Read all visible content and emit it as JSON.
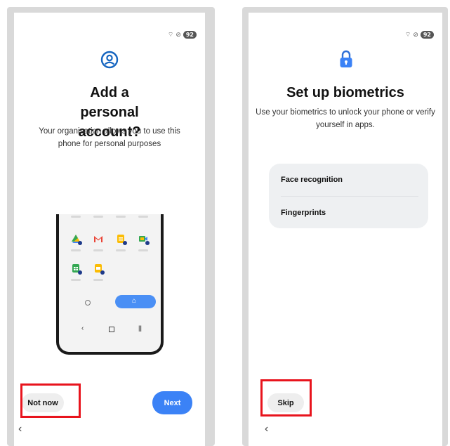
{
  "left_screen": {
    "status": {
      "battery": "92"
    },
    "icon": "account-circle-icon",
    "title": "Add a personal account?",
    "subtitle": "Your organisation allows you to use this phone for personal purposes",
    "apps": [
      "drive-icon",
      "gmail-icon",
      "docs-icon",
      "meet-icon",
      "sheets-icon",
      "slides-icon"
    ],
    "not_now_label": "Not now",
    "next_label": "Next"
  },
  "right_screen": {
    "status": {
      "battery": "92"
    },
    "icon": "lock-icon",
    "title": "Set up biometrics",
    "subtitle": "Use your biometrics to unlock your phone or verify yourself in apps.",
    "options": [
      "Face recognition",
      "Fingerprints"
    ],
    "skip_label": "Skip"
  },
  "colors": {
    "accent": "#3b82f6",
    "highlight": "#e8141d",
    "pill_gray": "#eeeeee"
  }
}
